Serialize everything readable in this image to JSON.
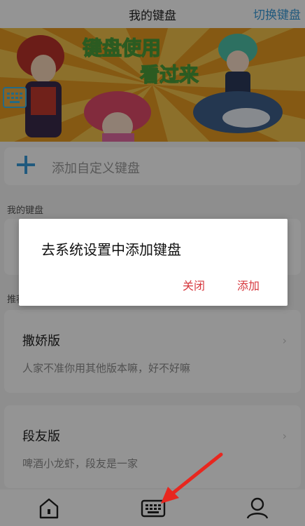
{
  "header": {
    "title": "我的键盘",
    "switch_label": "切换键盘"
  },
  "banner": {
    "headline_line1": "键盘使用",
    "headline_line2": "看过来",
    "kbd_icon": "keyboard-icon"
  },
  "add_custom": {
    "icon": "plus-icon",
    "label": "添加自定义键盘"
  },
  "my_keyboards": {
    "section_label": "我的键盘"
  },
  "recommend": {
    "section_label": "推荐",
    "cards": [
      {
        "name": "撒娇版",
        "desc": "人家不准你用其他版本嘛，好不好嘛"
      },
      {
        "name": "段友版",
        "desc": "啤酒小龙虾，段友是一家"
      }
    ]
  },
  "dialog": {
    "title": "去系统设置中添加键盘",
    "close_label": "关闭",
    "add_label": "添加"
  },
  "bottom_nav": {
    "items": [
      {
        "icon": "home-icon"
      },
      {
        "icon": "keyboard-icon"
      },
      {
        "icon": "user-icon"
      }
    ]
  },
  "colors": {
    "accent": "#3a9bd9",
    "dialog_action": "#d6373d",
    "annotation_arrow": "#e8271f"
  }
}
